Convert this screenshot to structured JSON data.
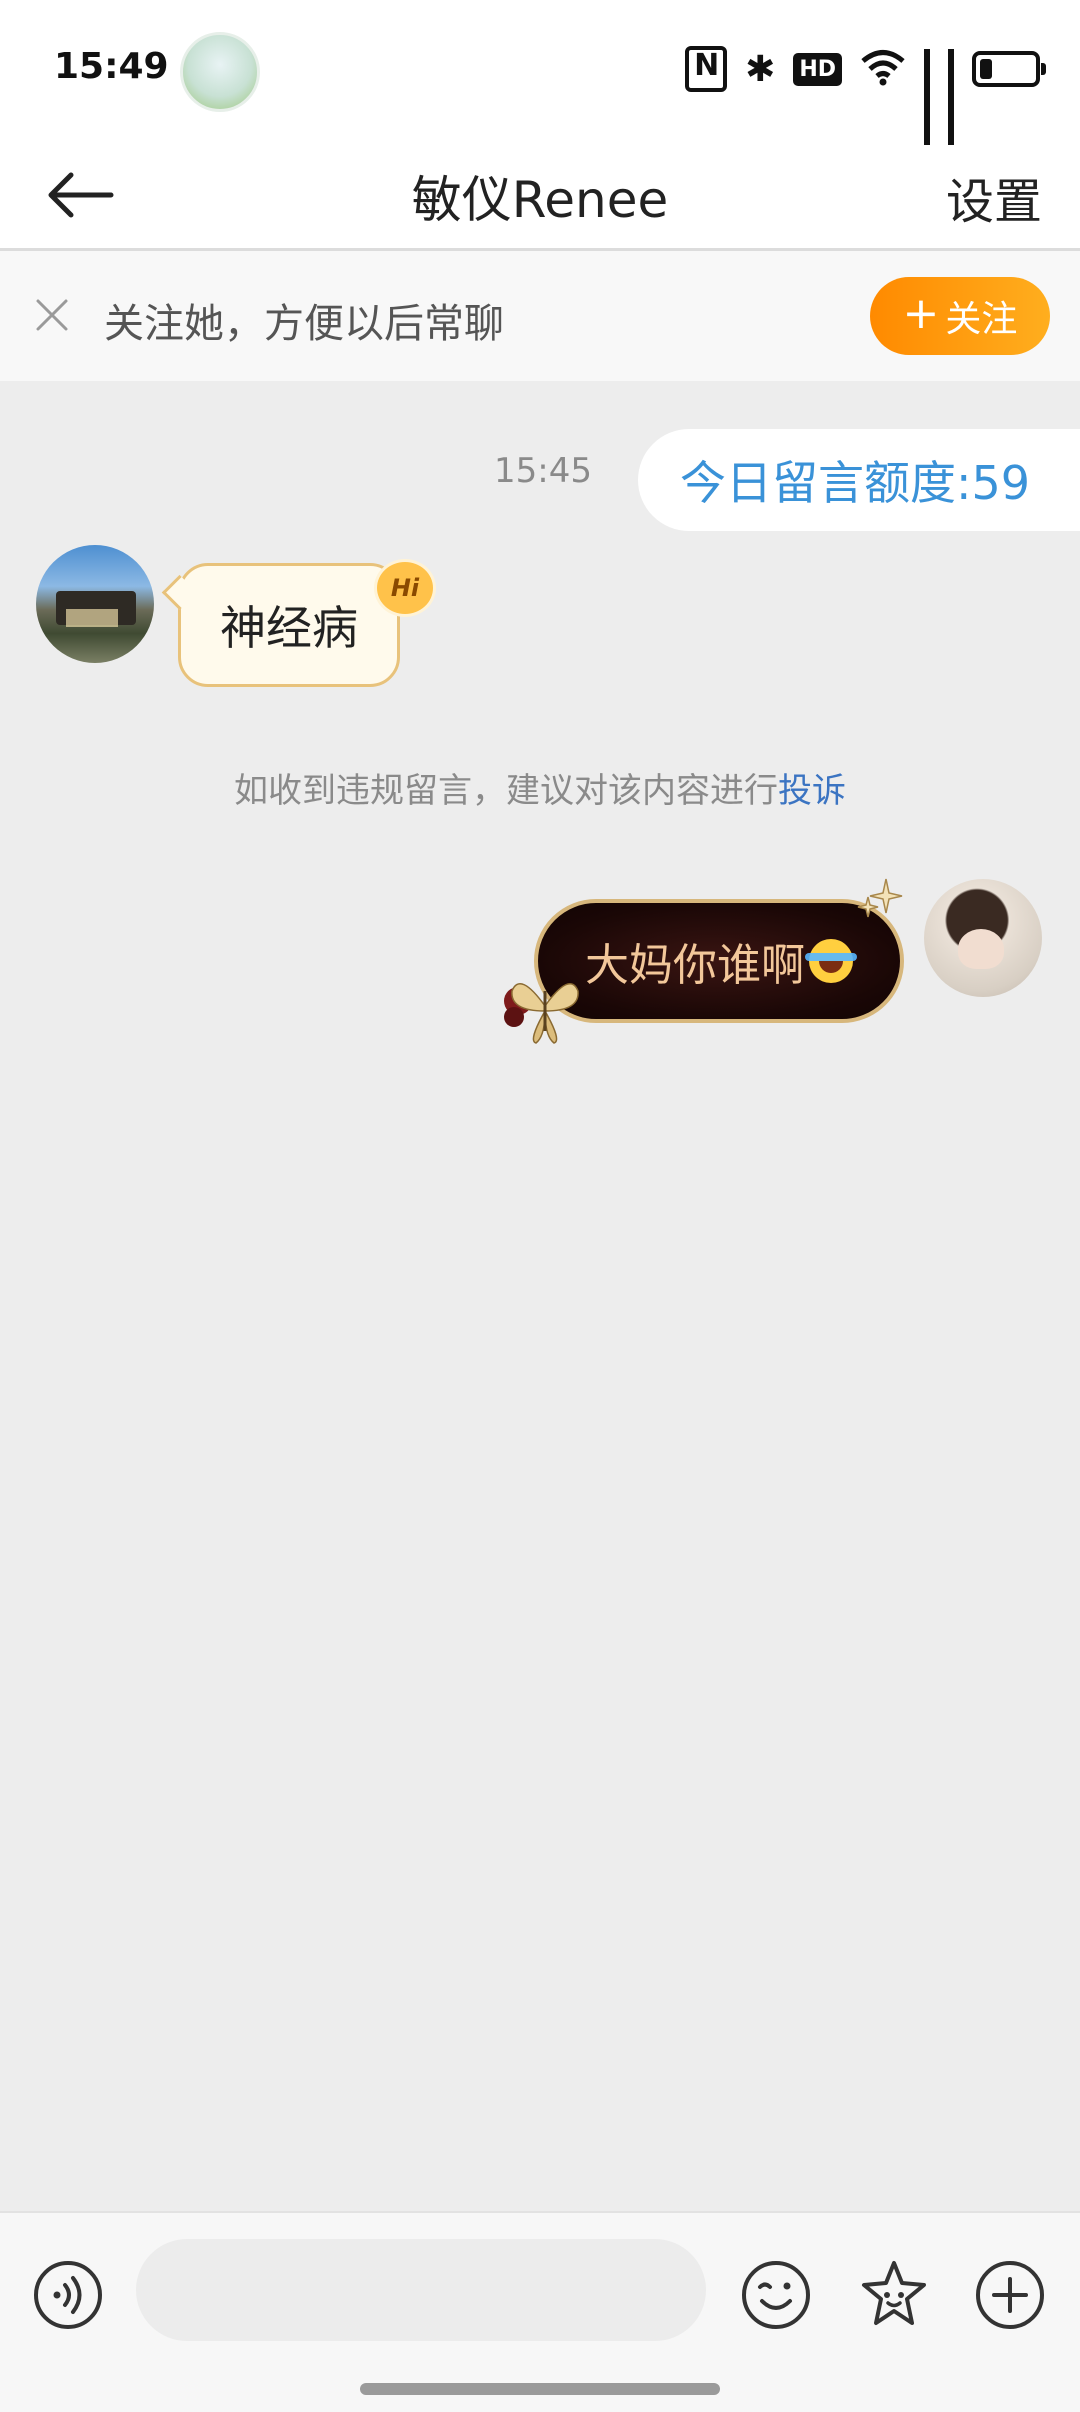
{
  "status_bar": {
    "time": "15:49",
    "icons": [
      "nfc-icon",
      "bluetooth-icon",
      "hd-icon",
      "wifi-icon",
      "5g-signal-icon",
      "5g-signal-icon",
      "battery-icon"
    ],
    "hd_label": "HD"
  },
  "nav": {
    "title": "敏仪Renee",
    "settings_label": "设置"
  },
  "follow_banner": {
    "text": "关注她，方便以后常聊",
    "button_label": "关注",
    "accent_color": "#ff8a00"
  },
  "chat": {
    "timestamp": "15:45",
    "quota_text": "今日留言额度:59",
    "incoming": {
      "text": "神经病",
      "badge": "Hi"
    },
    "notice": {
      "prefix": "如收到违规留言，建议对该内容进行",
      "link": "投诉"
    },
    "outgoing": {
      "text": "大妈你谁啊",
      "emoji": "rolling-on-floor-laughing-emoji"
    }
  },
  "input": {
    "placeholder": ""
  },
  "colors": {
    "link_blue": "#3b74c2",
    "quota_blue": "#3a92d8",
    "chat_background": "#ededed"
  }
}
